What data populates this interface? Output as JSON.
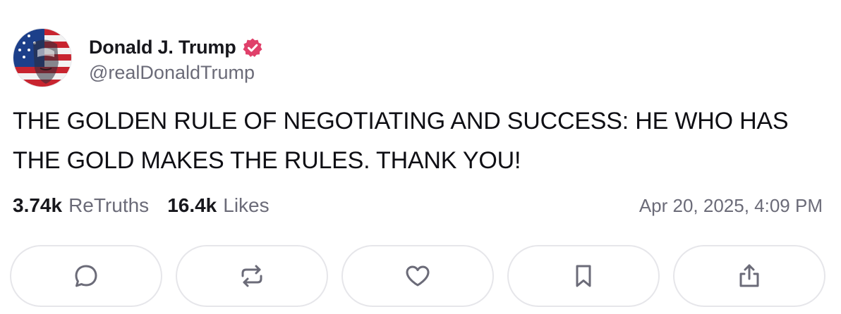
{
  "author": {
    "display_name": "Donald J. Trump",
    "handle": "@realDonaldTrump",
    "avatar_icon": "avatar-flag-portrait",
    "verified_icon": "verified-badge-icon",
    "verified_color": "#e0406a"
  },
  "post": {
    "text": "THE GOLDEN RULE OF NEGOTIATING AND SUCCESS: HE WHO HAS THE GOLD MAKES THE RULES. THANK YOU!"
  },
  "stats": {
    "retruths_count": "3.74k",
    "retruths_label": "ReTruths",
    "likes_count": "16.4k",
    "likes_label": "Likes",
    "timestamp": "Apr 20, 2025, 4:09 PM"
  },
  "actions": [
    {
      "name": "reply",
      "icon": "comment-icon"
    },
    {
      "name": "retruth",
      "icon": "repost-icon"
    },
    {
      "name": "like",
      "icon": "heart-icon"
    },
    {
      "name": "bookmark",
      "icon": "bookmark-icon"
    },
    {
      "name": "share",
      "icon": "share-icon"
    }
  ],
  "colors": {
    "text": "#0f0f14",
    "muted": "#6b6b78",
    "border": "#e6e6ea",
    "icon": "#6b6b78"
  }
}
